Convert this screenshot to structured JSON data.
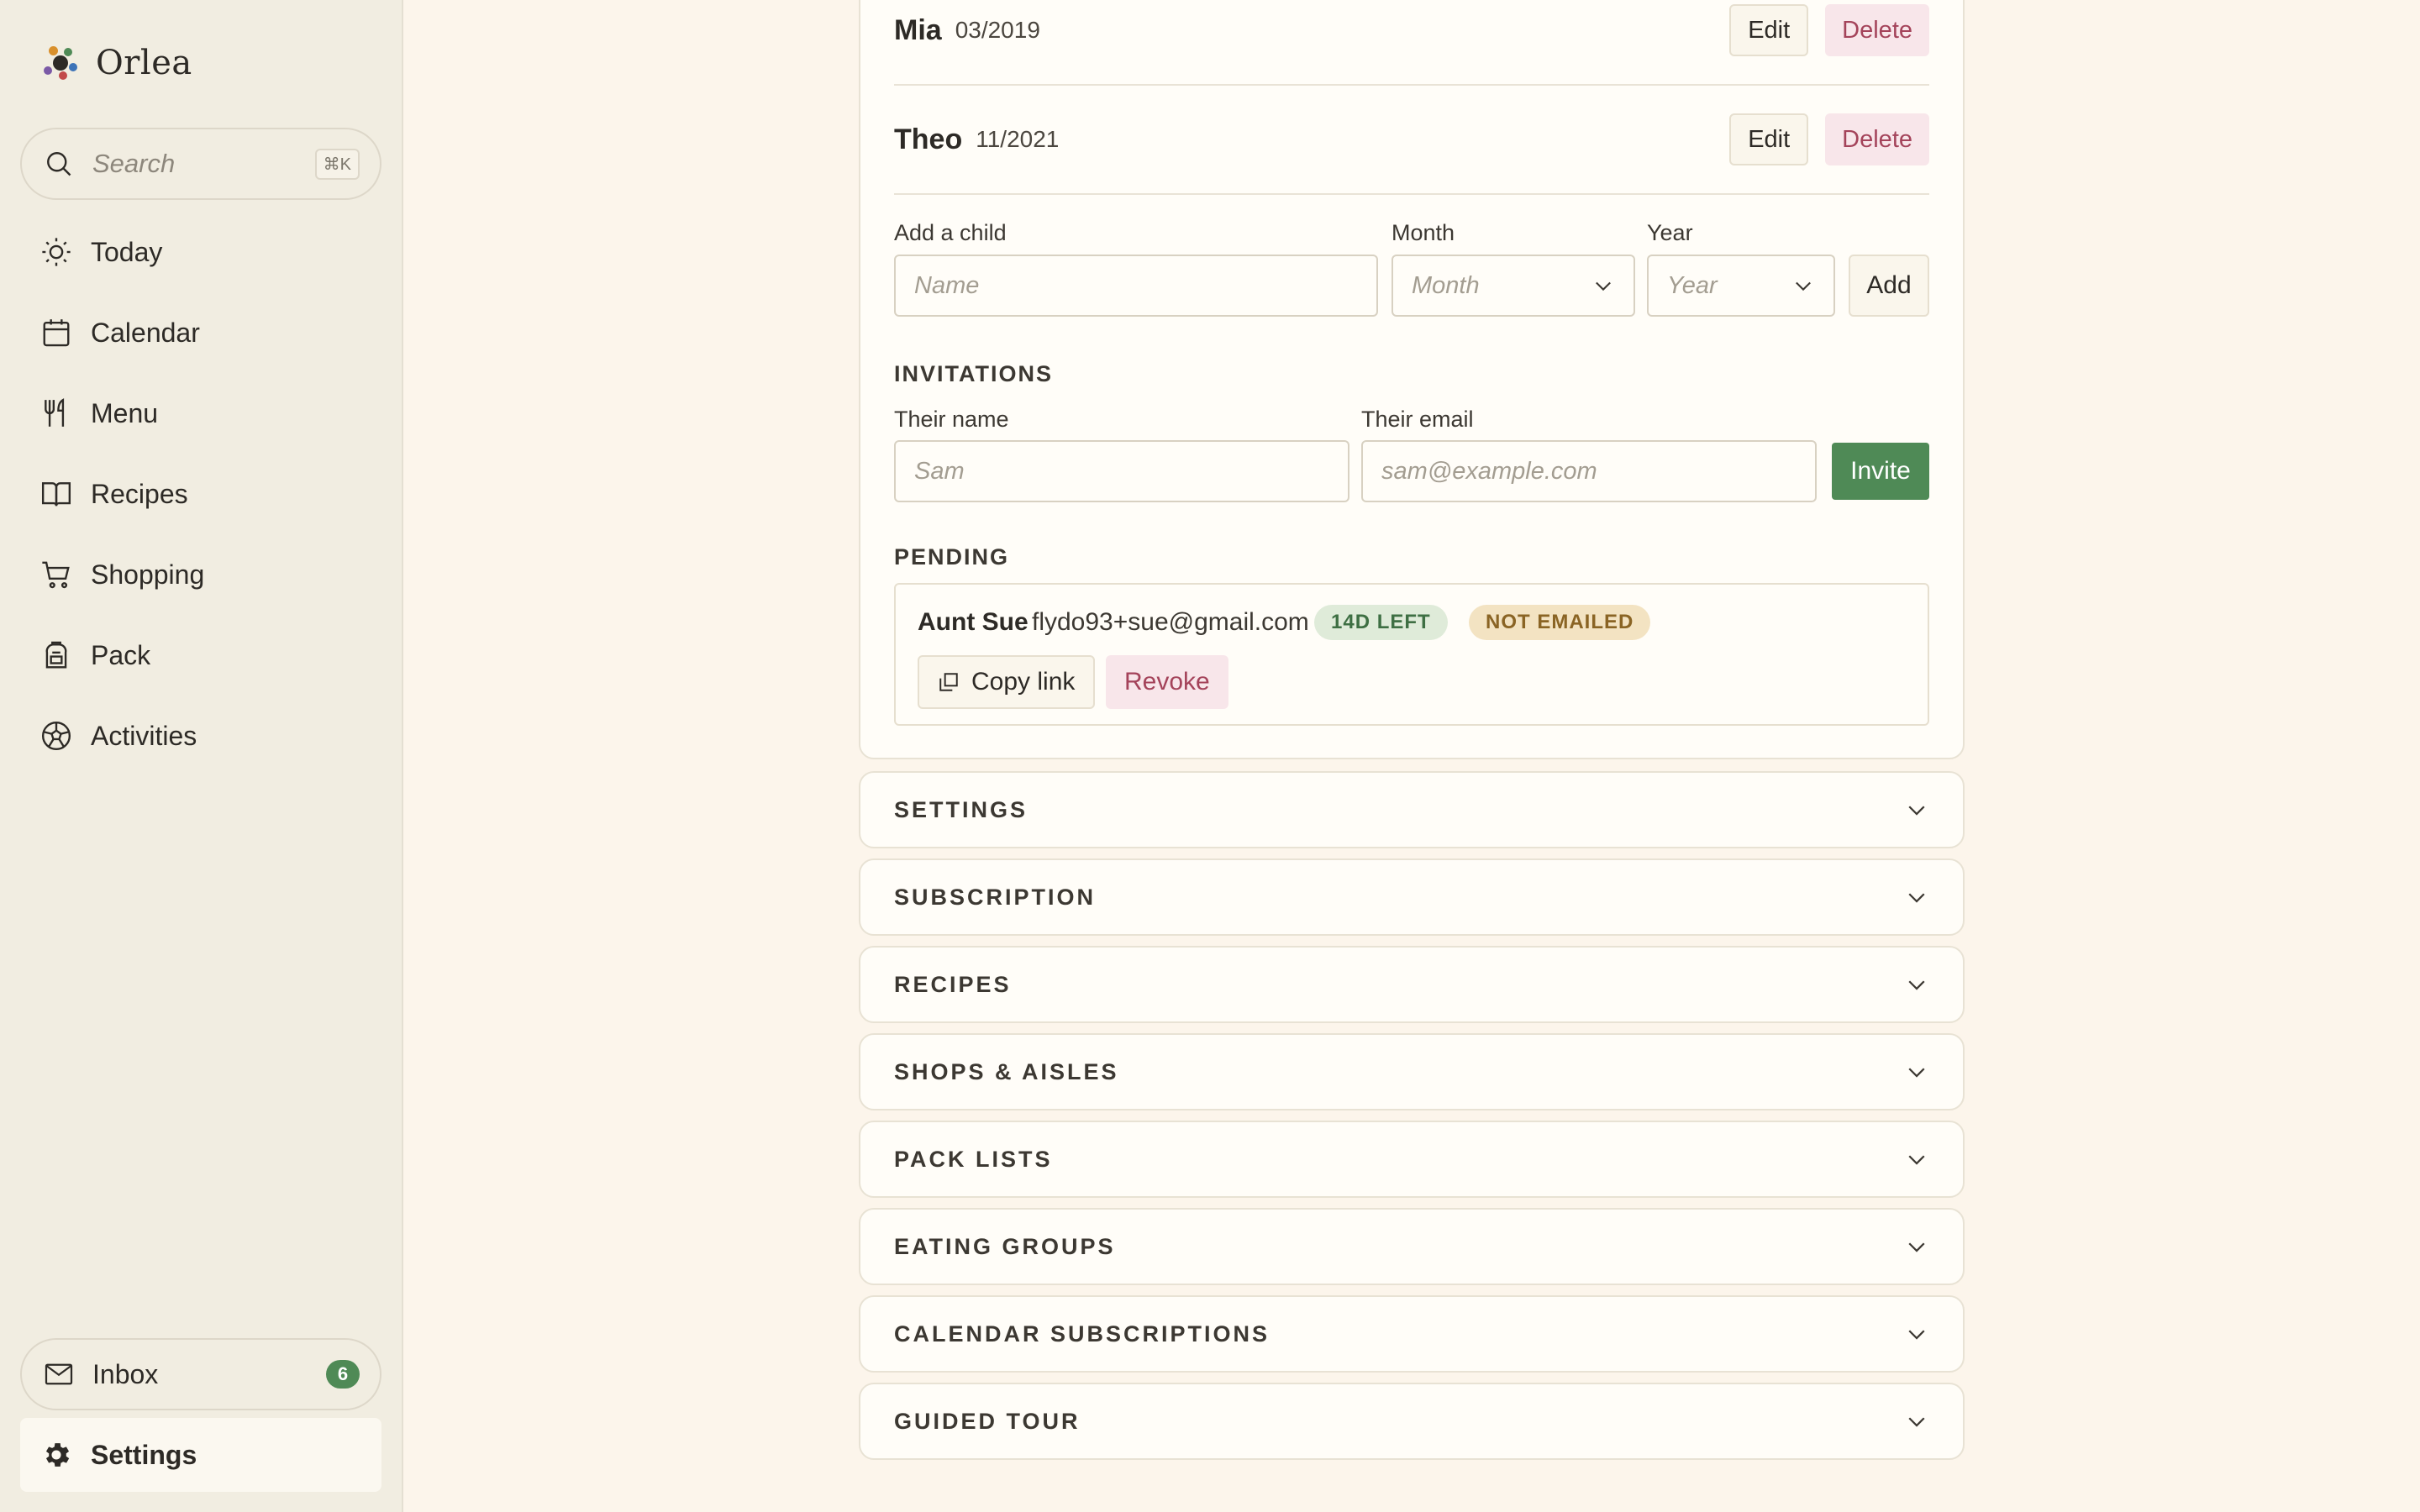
{
  "app": {
    "name": "Orlea"
  },
  "search": {
    "placeholder": "Search",
    "shortcut": "⌘K"
  },
  "nav": {
    "items": [
      {
        "label": "Today",
        "icon": "sun-icon"
      },
      {
        "label": "Calendar",
        "icon": "calendar-icon"
      },
      {
        "label": "Menu",
        "icon": "utensils-icon"
      },
      {
        "label": "Recipes",
        "icon": "book-icon"
      },
      {
        "label": "Shopping",
        "icon": "cart-icon"
      },
      {
        "label": "Pack",
        "icon": "backpack-icon"
      },
      {
        "label": "Activities",
        "icon": "ball-icon"
      }
    ],
    "inbox": {
      "label": "Inbox",
      "count": "6"
    },
    "settings": {
      "label": "Settings"
    }
  },
  "children": [
    {
      "name": "Mia",
      "date": "03/2019",
      "edit": "Edit",
      "delete": "Delete"
    },
    {
      "name": "Theo",
      "date": "11/2021",
      "edit": "Edit",
      "delete": "Delete"
    }
  ],
  "add_child": {
    "label": "Add a child",
    "name_placeholder": "Name",
    "month_label": "Month",
    "month_placeholder": "Month",
    "year_label": "Year",
    "year_placeholder": "Year",
    "add_button": "Add"
  },
  "invitations": {
    "heading": "INVITATIONS",
    "name_label": "Their name",
    "name_placeholder": "Sam",
    "email_label": "Their email",
    "email_placeholder": "sam@example.com",
    "invite_button": "Invite"
  },
  "pending": {
    "heading": "PENDING",
    "items": [
      {
        "name": "Aunt Sue",
        "email": "flydo93+sue@gmail.com",
        "time_badge": "14D LEFT",
        "status_badge": "NOT EMAILED",
        "copy_link": "Copy link",
        "revoke": "Revoke"
      }
    ]
  },
  "sections": [
    "SETTINGS",
    "SUBSCRIPTION",
    "RECIPES",
    "SHOPS & AISLES",
    "PACK LISTS",
    "EATING GROUPS",
    "CALENDAR SUBSCRIPTIONS",
    "GUIDED TOUR"
  ],
  "colors": {
    "accent_green": "#4f8a56",
    "danger": "#a4435a",
    "background": "#fcf5eb",
    "sidebar": "#f1ede1"
  }
}
